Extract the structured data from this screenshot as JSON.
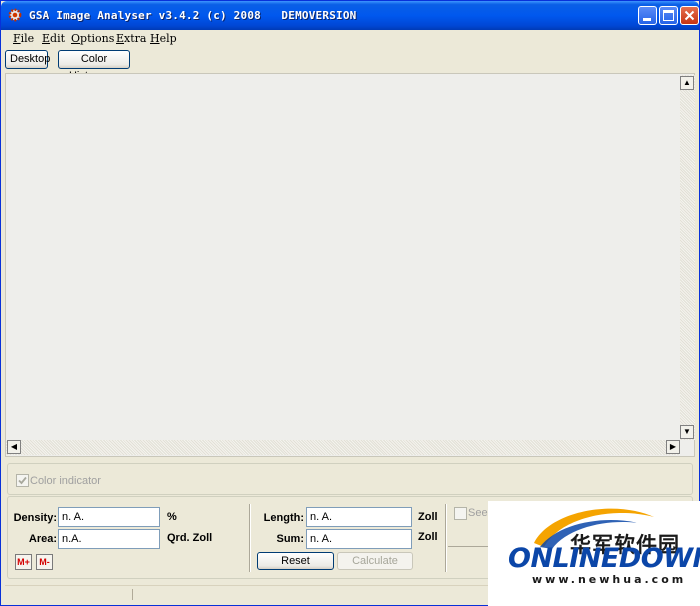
{
  "window": {
    "title": "GSA Image Analyser v3.4.2 (c) 2008   DEMOVERSION",
    "controls": {
      "minimize": "minimize-icon",
      "maximize": "maximize-icon",
      "close": "close-icon"
    }
  },
  "menu": {
    "items": [
      {
        "mnemonic": "F",
        "rest": "ile"
      },
      {
        "mnemonic": "E",
        "rest": "dit"
      },
      {
        "mnemonic": "O",
        "rest": "ptions"
      },
      {
        "mnemonic": "E",
        "rest": "xtra"
      },
      {
        "mnemonic": "H",
        "rest": "elp"
      }
    ]
  },
  "tabs": [
    {
      "label": "Desktop"
    },
    {
      "label": "Color Histogram"
    }
  ],
  "panel": {
    "color_indicator": {
      "label": "Color indicator",
      "checked": true
    },
    "density": {
      "label": "Density:",
      "value": "n. A.",
      "unit": "%"
    },
    "area": {
      "label": "Area:",
      "value": "n.A.",
      "unit": "Qrd. Zoll"
    },
    "memory_add": "M+",
    "memory_sub": "M-",
    "length": {
      "label": "Length:",
      "value": "n. A.",
      "unit": "Zoll"
    },
    "sum": {
      "label": "Sum:",
      "value": "n. A.",
      "unit": "Zoll"
    },
    "reset": "Reset",
    "calculate": "Calculate",
    "see_option": {
      "label": "See",
      "checked": false
    }
  },
  "watermark": {
    "chinese": "华军软件园",
    "logo": "ONLINEDOWN",
    "url": "www.newhua.com"
  },
  "colors": {
    "titlebar": "#0058ee",
    "face": "#ece9d8",
    "accent_red": "#d40000",
    "logo_blue": "#0b46a8",
    "logo_orange": "#f5a400"
  }
}
